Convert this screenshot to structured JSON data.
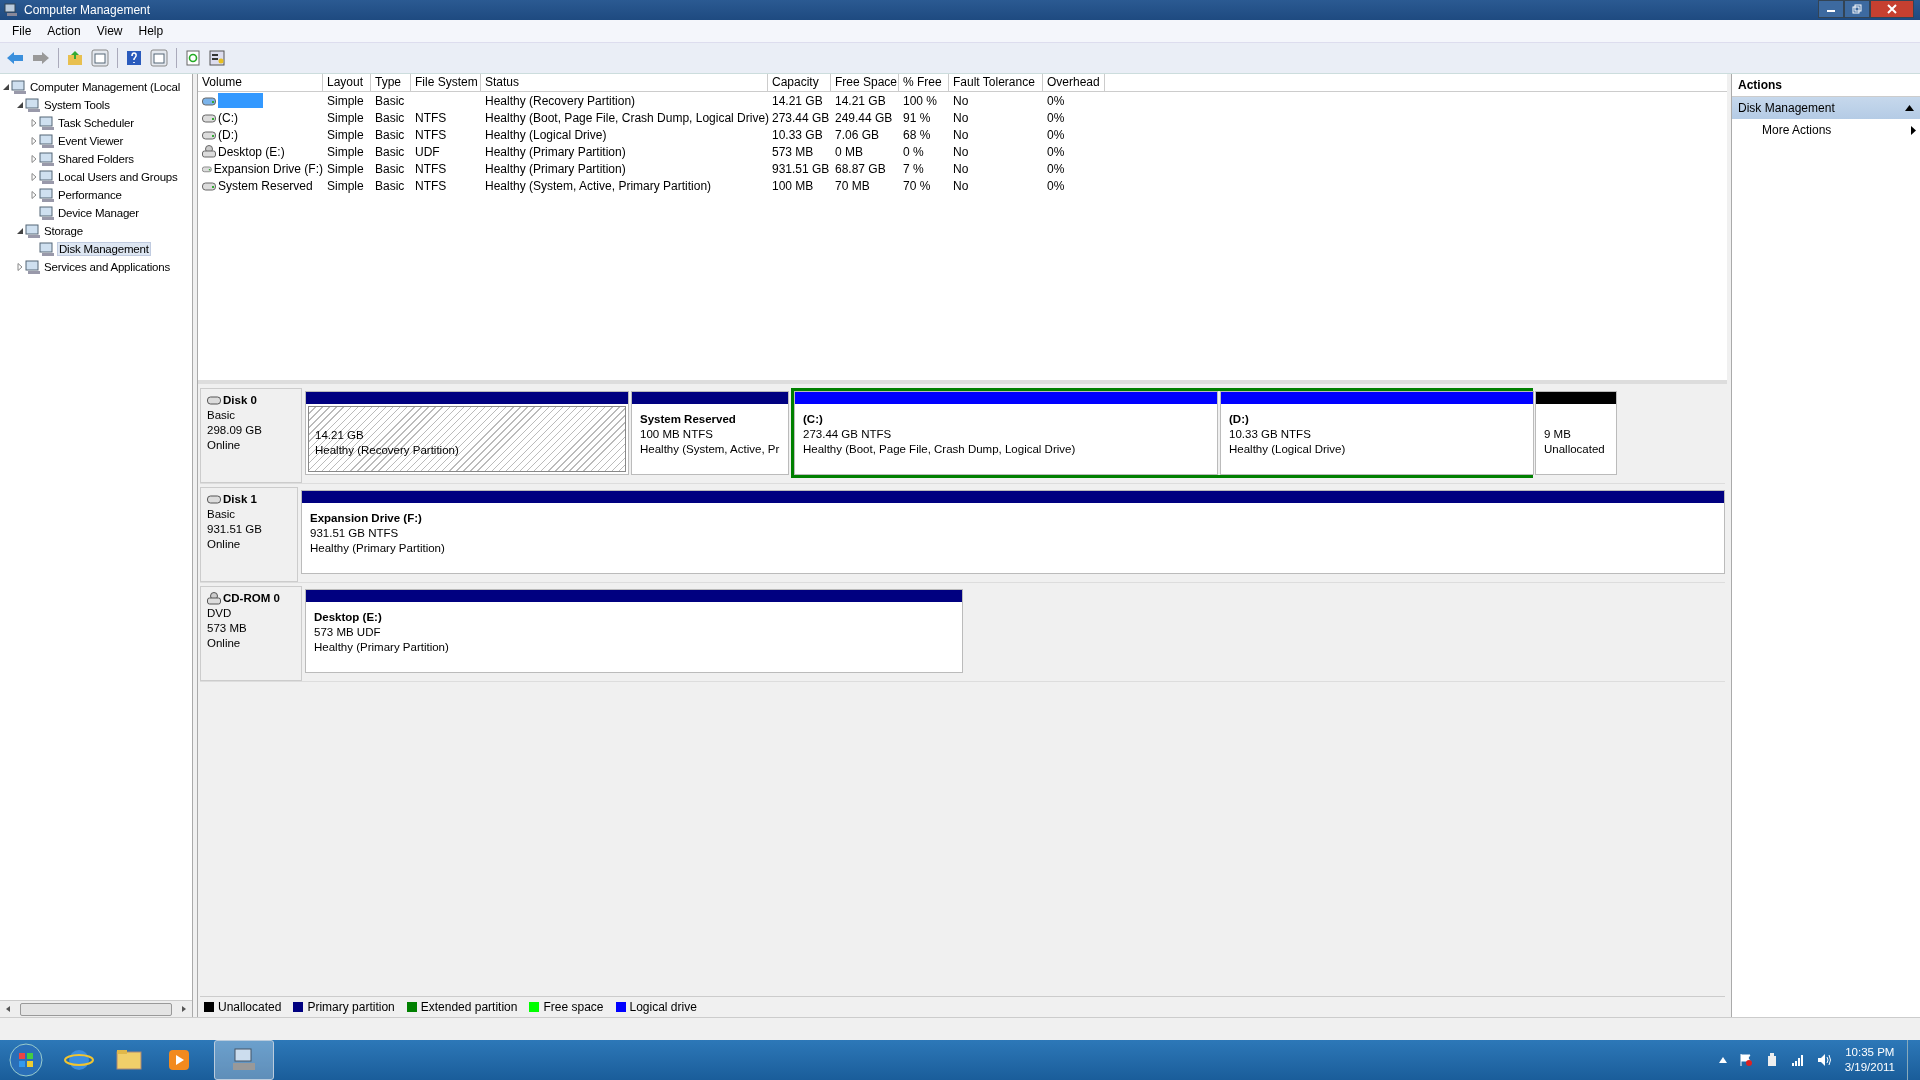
{
  "window": {
    "title": "Computer Management"
  },
  "menu": [
    "File",
    "Action",
    "View",
    "Help"
  ],
  "tree": [
    {
      "label": "Computer Management (Local",
      "expanded": true,
      "selected": false,
      "children": [
        {
          "label": "System Tools",
          "expanded": true,
          "selected": false,
          "children": [
            {
              "label": "Task Scheduler",
              "expanded": false,
              "selected": false
            },
            {
              "label": "Event Viewer",
              "expanded": false,
              "selected": false
            },
            {
              "label": "Shared Folders",
              "expanded": false,
              "selected": false
            },
            {
              "label": "Local Users and Groups",
              "expanded": false,
              "selected": false
            },
            {
              "label": "Performance",
              "expanded": false,
              "selected": false
            },
            {
              "label": "Device Manager",
              "selected": false
            }
          ]
        },
        {
          "label": "Storage",
          "expanded": true,
          "selected": false,
          "children": [
            {
              "label": "Disk Management",
              "selected": true
            }
          ]
        },
        {
          "label": "Services and Applications",
          "expanded": false,
          "selected": false
        }
      ]
    }
  ],
  "volume_table": {
    "columns": [
      "Volume",
      "Layout",
      "Type",
      "File System",
      "Status",
      "Capacity",
      "Free Space",
      "% Free",
      "Fault Tolerance",
      "Overhead"
    ],
    "rows": [
      {
        "kind": "hdd",
        "selected": true,
        "cells": [
          "",
          "Simple",
          "Basic",
          "",
          "Healthy (Recovery Partition)",
          "14.21 GB",
          "14.21 GB",
          "100 %",
          "No",
          "0%"
        ]
      },
      {
        "kind": "hdd",
        "selected": false,
        "cells": [
          "(C:)",
          "Simple",
          "Basic",
          "NTFS",
          "Healthy (Boot, Page File, Crash Dump, Logical Drive)",
          "273.44 GB",
          "249.44 GB",
          "91 %",
          "No",
          "0%"
        ]
      },
      {
        "kind": "hdd",
        "selected": false,
        "cells": [
          "(D:)",
          "Simple",
          "Basic",
          "NTFS",
          "Healthy (Logical Drive)",
          "10.33 GB",
          "7.06 GB",
          "68 %",
          "No",
          "0%"
        ]
      },
      {
        "kind": "cdrom",
        "selected": false,
        "cells": [
          "Desktop (E:)",
          "Simple",
          "Basic",
          "UDF",
          "Healthy (Primary Partition)",
          "573 MB",
          "0 MB",
          "0 %",
          "No",
          "0%"
        ]
      },
      {
        "kind": "hdd",
        "selected": false,
        "cells": [
          "Expansion Drive (F:)",
          "Simple",
          "Basic",
          "NTFS",
          "Healthy (Primary Partition)",
          "931.51 GB",
          "68.87 GB",
          "7 %",
          "No",
          "0%"
        ]
      },
      {
        "kind": "hdd",
        "selected": false,
        "cells": [
          "System Reserved",
          "Simple",
          "Basic",
          "NTFS",
          "Healthy (System, Active, Primary Partition)",
          "100 MB",
          "70 MB",
          "70 %",
          "No",
          "0%"
        ]
      }
    ]
  },
  "disks": [
    {
      "kind": "hdd",
      "name": "Disk 0",
      "type": "Basic",
      "size": "298.09 GB",
      "status": "Online",
      "partitions": [
        {
          "kind": "primary",
          "selected": true,
          "size": "14.21 GB",
          "status": "Healthy (Recovery Partition)"
        },
        {
          "kind": "primary",
          "selected": false,
          "name": "System Reserved",
          "size": "100 MB NTFS",
          "status": "Healthy (System, Active, Pr"
        },
        {
          "kind": "extended",
          "children": [
            {
              "kind": "logical",
              "selected": false,
              "name": "(C:)",
              "size": "273.44 GB NTFS",
              "status": "Healthy (Boot, Page File, Crash Dump, Logical Drive)"
            },
            {
              "kind": "logical",
              "selected": false,
              "name": "(D:)",
              "size": "10.33 GB NTFS",
              "status": "Healthy (Logical Drive)"
            }
          ]
        },
        {
          "kind": "unallocated",
          "selected": false,
          "size": "9 MB",
          "status": "Unallocated"
        }
      ]
    },
    {
      "kind": "hdd",
      "name": "Disk 1",
      "type": "Basic",
      "size": "931.51 GB",
      "status": "Online",
      "partitions": [
        {
          "kind": "primary",
          "selected": false,
          "name": "Expansion Drive  (F:)",
          "size": "931.51 GB NTFS",
          "status": "Healthy (Primary Partition)"
        }
      ]
    },
    {
      "kind": "cdrom",
      "name": "CD-ROM 0",
      "type": "DVD",
      "size": "573 MB",
      "status": "Online",
      "partitions": [
        {
          "kind": "primary",
          "selected": false,
          "name": "Desktop  (E:)",
          "size": "573 MB UDF",
          "status": "Healthy (Primary Partition)"
        }
      ]
    }
  ],
  "legend": [
    {
      "label": "Unallocated",
      "color": "#000000"
    },
    {
      "label": "Primary partition",
      "color": "#000080"
    },
    {
      "label": "Extended partition",
      "color": "#008000"
    },
    {
      "label": "Free space",
      "color": "#00ff00"
    },
    {
      "label": "Logical drive",
      "color": "#0000ff"
    }
  ],
  "actions": {
    "title": "Actions",
    "section": {
      "label": "Disk Management",
      "expanded": true
    },
    "items": [
      "More Actions"
    ]
  },
  "taskbar": {
    "clock": {
      "time": "10:35 PM",
      "date": "3/19/2011"
    }
  }
}
